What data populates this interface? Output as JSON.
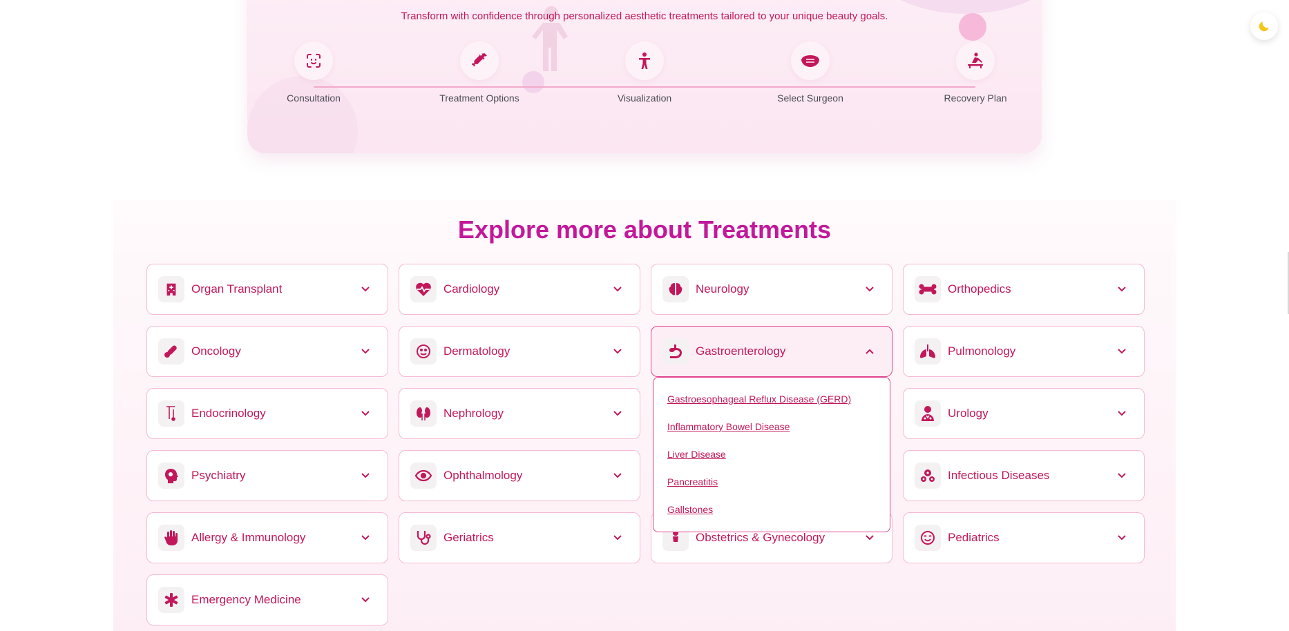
{
  "journey": {
    "subtitle": "Transform with confidence through personalized aesthetic treatments tailored to your unique beauty goals.",
    "steps": [
      {
        "label": "Consultation",
        "icon": "face-scan-icon"
      },
      {
        "label": "Treatment Options",
        "icon": "syringe-icon"
      },
      {
        "label": "Visualization",
        "icon": "person-icon"
      },
      {
        "label": "Select Surgeon",
        "icon": "mask-icon"
      },
      {
        "label": "Recovery Plan",
        "icon": "massage-icon"
      }
    ]
  },
  "theme_toggle": {
    "icon": "moon-icon",
    "color": "#f5c518"
  },
  "explore": {
    "title": "Explore more about Treatments",
    "items": [
      {
        "label": "Organ Transplant",
        "icon": "hospital-icon"
      },
      {
        "label": "Cardiology",
        "icon": "heart-pulse-icon"
      },
      {
        "label": "Neurology",
        "icon": "brain-icon"
      },
      {
        "label": "Orthopedics",
        "icon": "bone-icon"
      },
      {
        "label": "Oncology",
        "icon": "pills-icon"
      },
      {
        "label": "Dermatology",
        "icon": "face-icon"
      },
      {
        "label": "Gastroenterology",
        "icon": "stomach-icon",
        "expanded": true
      },
      {
        "label": "Pulmonology",
        "icon": "lungs-icon"
      },
      {
        "label": "Endocrinology",
        "icon": "thermometer-icon"
      },
      {
        "label": "Nephrology",
        "icon": "kidneys-icon"
      },
      {
        "label": "Urology",
        "icon": "doctor-icon"
      },
      {
        "label": "Psychiatry",
        "icon": "head-brain-icon"
      },
      {
        "label": "Ophthalmology",
        "icon": "eye-icon"
      },
      {
        "label": "Infectious Diseases",
        "icon": "virus-icon"
      },
      {
        "label": "Allergy & Immunology",
        "icon": "hand-icon"
      },
      {
        "label": "Geriatrics",
        "icon": "stethoscope-icon"
      },
      {
        "label": "Obstetrics & Gynecology",
        "icon": "baby-icon"
      },
      {
        "label": "Pediatrics",
        "icon": "smile-face-icon"
      },
      {
        "label": "Emergency Medicine",
        "icon": "asterisk-icon"
      }
    ],
    "gastro_links": [
      "Gastroesophageal Reflux Disease (GERD)",
      "Inflammatory Bowel Disease",
      "Liver Disease",
      "Pancreatitis",
      "Gallstones"
    ]
  },
  "colors": {
    "accent": "#c2185b",
    "title": "#c2199b",
    "border": "#f6b9d4"
  }
}
